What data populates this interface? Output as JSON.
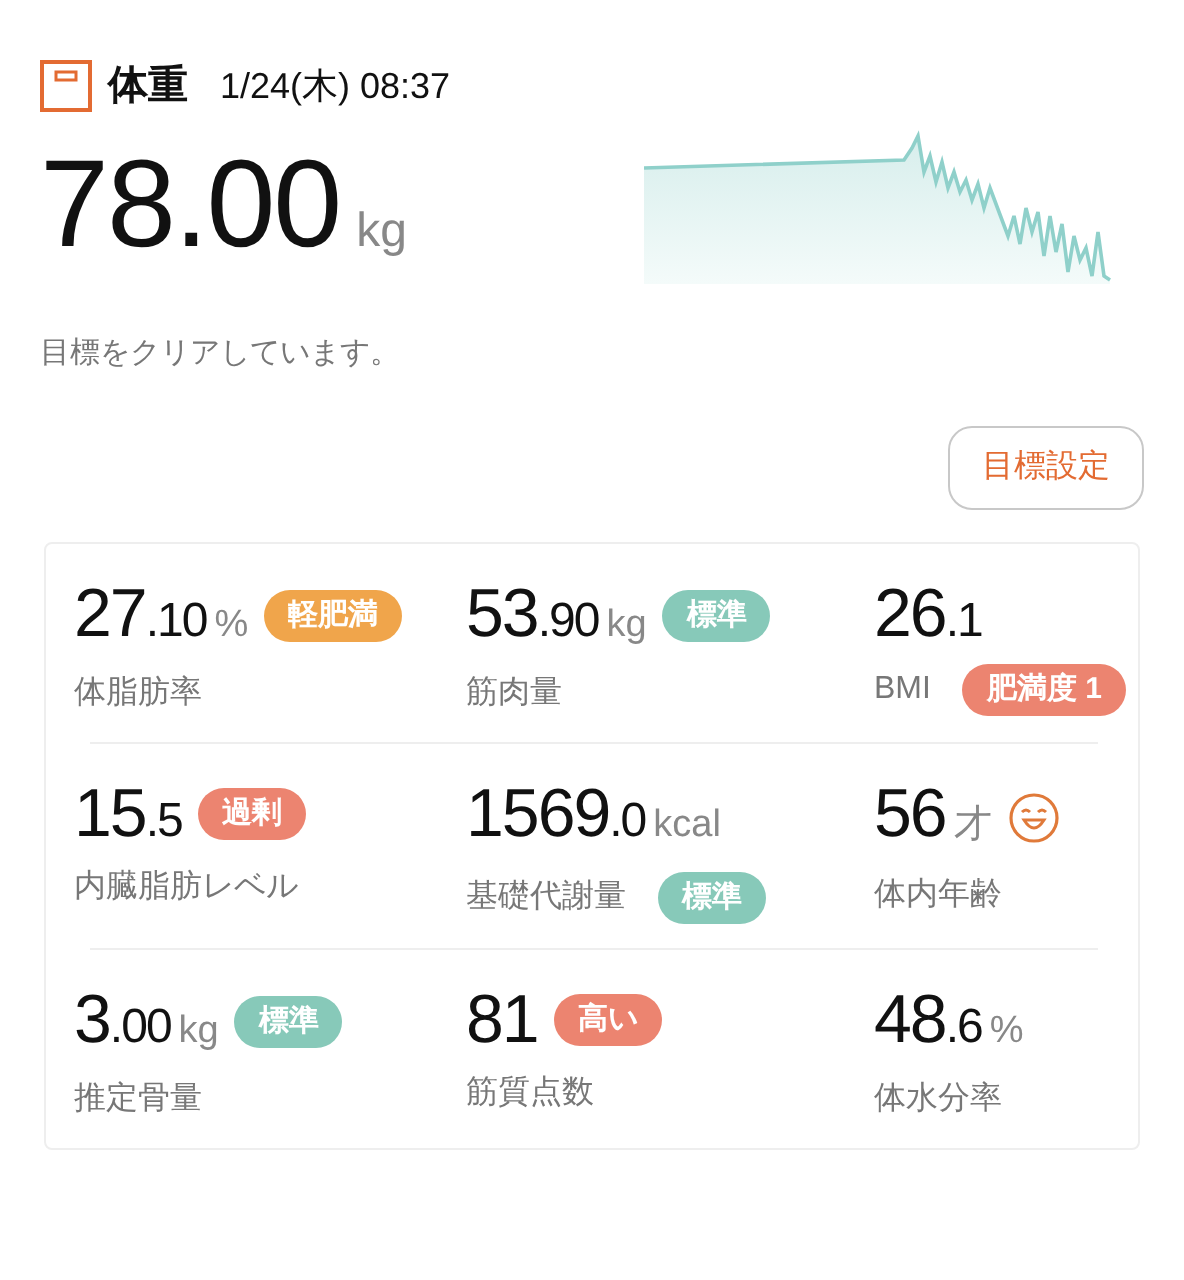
{
  "header": {
    "title": "体重",
    "datetime": "1/24(木) 08:37"
  },
  "weight": {
    "integer": "78",
    "decimal": ".00",
    "unit": "kg"
  },
  "goal_message": "目標をクリアしています。",
  "goal_button": "目標設定",
  "metrics": [
    {
      "kind": "plain",
      "integer": "27",
      "decimal": ".10",
      "unit": "%",
      "label": "体脂肪率",
      "value_badge": {
        "text": "軽肥満",
        "color": "#f0a54b"
      }
    },
    {
      "kind": "plain",
      "integer": "53",
      "decimal": ".90",
      "unit": "kg",
      "label": "筋肉量",
      "value_badge": {
        "text": "標準",
        "color": "#87c9b9"
      }
    },
    {
      "kind": "plain",
      "integer": "26",
      "decimal": ".1",
      "label": "BMI",
      "label_badge": {
        "text": "肥満度 1",
        "color": "#ec8470"
      }
    },
    {
      "kind": "plain",
      "integer": "15",
      "decimal": ".5",
      "label": "内臓脂肪レベル",
      "value_badge": {
        "text": "過剰",
        "color": "#ec8470"
      }
    },
    {
      "kind": "plain",
      "integer": "1569",
      "decimal": ".0",
      "unit": "kcal",
      "label": "基礎代謝量",
      "label_badge": {
        "text": "標準",
        "color": "#87c9b9"
      }
    },
    {
      "kind": "face",
      "integer": "56",
      "unit": "才",
      "label": "体内年齢"
    },
    {
      "kind": "plain",
      "integer": "3",
      "decimal": ".00",
      "unit": "kg",
      "label": "推定骨量",
      "value_badge": {
        "text": "標準",
        "color": "#87c9b9"
      }
    },
    {
      "kind": "plain",
      "integer": "81",
      "label": "筋質点数",
      "value_badge": {
        "text": "高い",
        "color": "#ec8470"
      }
    },
    {
      "kind": "plain",
      "integer": "48",
      "decimal": ".6",
      "unit": "%",
      "label": "体水分率"
    }
  ]
}
